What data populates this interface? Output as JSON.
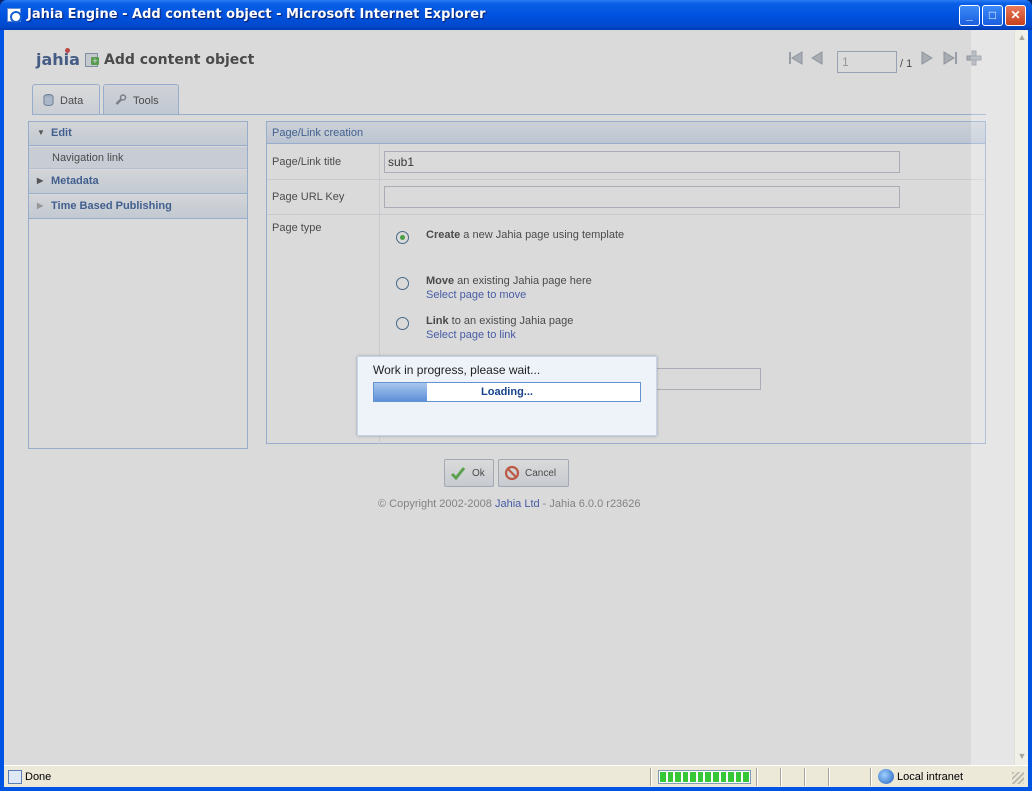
{
  "window": {
    "title": "Jahia Engine - Add content object - Microsoft Internet Explorer",
    "minimize_label": "_",
    "maximize_label": "□",
    "close_label": "✕"
  },
  "header": {
    "logo": "jahia",
    "title": "Add content object",
    "pager": {
      "current": "1",
      "total": "/ 1"
    }
  },
  "tabs": [
    {
      "label": "Data"
    },
    {
      "label": "Tools"
    }
  ],
  "sidebar": {
    "sections": [
      {
        "label": "Edit",
        "expanded": true,
        "items": [
          "Navigation link"
        ]
      },
      {
        "label": "Metadata",
        "expanded": false
      },
      {
        "label": "Time Based Publishing",
        "expanded": false
      }
    ]
  },
  "form": {
    "panel_title": "Page/Link creation",
    "fields": {
      "title_label": "Page/Link title",
      "title_value": "sub1",
      "url_key_label": "Page URL Key",
      "url_key_value": "",
      "page_type_label": "Page type"
    },
    "options": [
      {
        "bold": "Create",
        "text": " a new Jahia page using template",
        "checked": true,
        "link": ""
      },
      {
        "bold": "Move",
        "text": " an existing Jahia page here",
        "checked": false,
        "link": "Select page to move"
      },
      {
        "bold": "Link",
        "text": " to an existing Jahia page",
        "checked": false,
        "link": "Select page to link"
      }
    ]
  },
  "buttons": {
    "ok": "Ok",
    "cancel": "Cancel"
  },
  "footer": {
    "copyright_prefix": "© Copyright 2002-2008 ",
    "company": "Jahia Ltd",
    "copyright_suffix": " - Jahia 6.0.0 r23626"
  },
  "progress": {
    "message": "Work in progress, please wait...",
    "label": "Loading...",
    "fraction": 0.2
  },
  "statusbar": {
    "status": "Done",
    "zone": "Local intranet",
    "segments": 12
  },
  "colors": {
    "accent": "#15428b",
    "link": "#1c3dad",
    "title_bar": "#0054e3"
  }
}
